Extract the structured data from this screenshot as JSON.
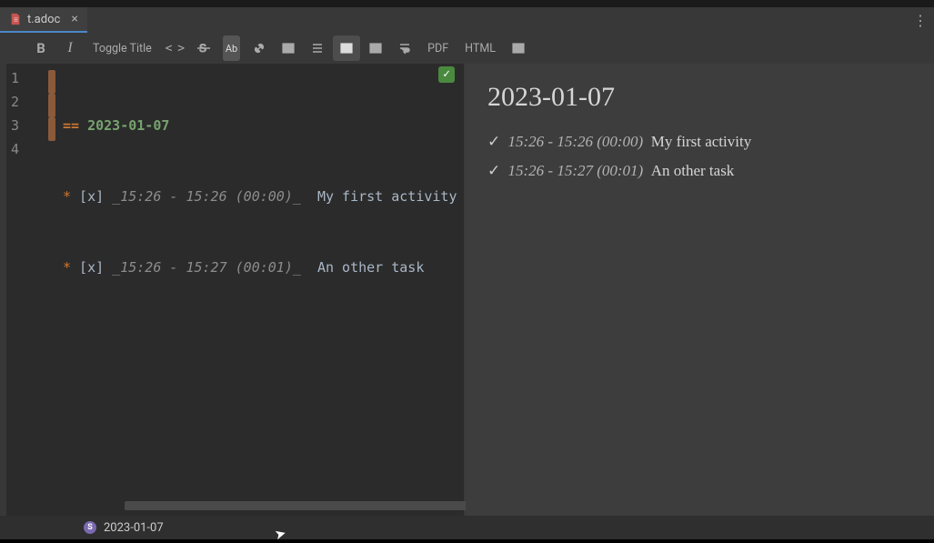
{
  "tab": {
    "filename": "t.adoc"
  },
  "toolbar": {
    "bold": "B",
    "italic": "I",
    "toggle_title": "Toggle Title",
    "code": "< >",
    "Ab": "Ab",
    "pdf": "PDF",
    "html": "HTML"
  },
  "editor": {
    "gutter": [
      "1",
      "2",
      "3",
      "4"
    ],
    "lines": [
      {
        "head_mark": "==",
        "head_text": " 2023-01-07"
      },
      {
        "bullet": "*",
        "checkbox": " [x] ",
        "time": "_15:26 - 15:26 (00:00)_",
        "sep": "  ",
        "text": "My first activity"
      },
      {
        "bullet": "*",
        "checkbox": " [x] ",
        "time": "_15:26 - 15:27 (00:01)_",
        "sep": "  ",
        "text": "An other task"
      },
      {
        "blank": ""
      }
    ]
  },
  "preview": {
    "heading": "2023-01-07",
    "items": [
      {
        "check": "✓",
        "time": "15:26 - 15:26 (00:00)",
        "task": "My first activity"
      },
      {
        "check": "✓",
        "time": "15:26 - 15:27 (00:01)",
        "task": "An other task"
      }
    ]
  },
  "status": {
    "badge": "S",
    "text": "2023-01-07"
  }
}
